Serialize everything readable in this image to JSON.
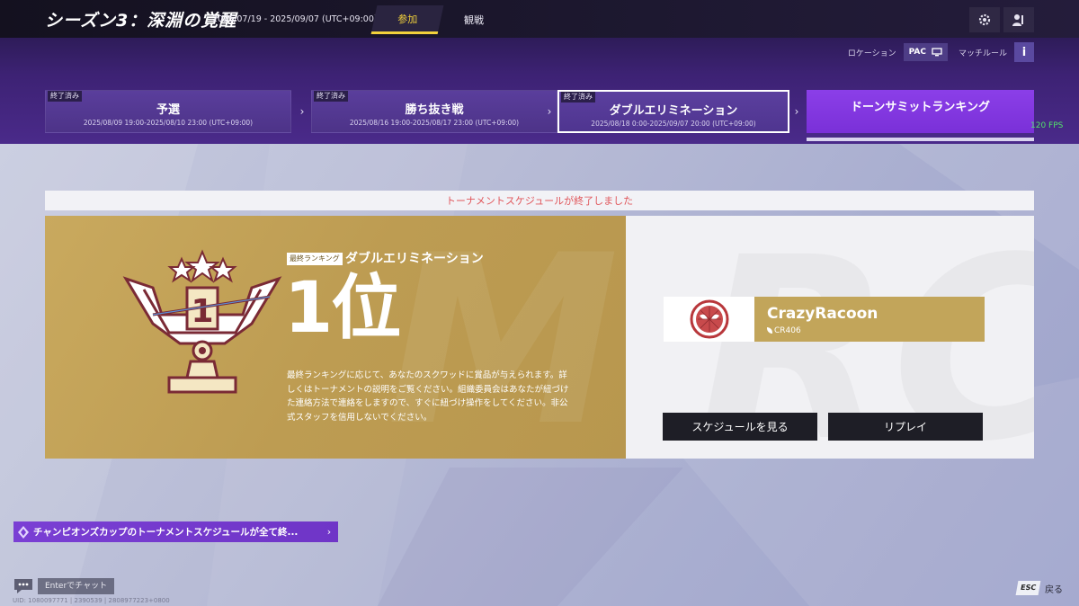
{
  "header": {
    "season_title": "シーズン3：深淵の覚醒",
    "season_dates": "2025/07/19 - 2025/09/07 (UTC+09:00)",
    "tabs": [
      {
        "label": "参加",
        "active": true
      },
      {
        "label": "観戦",
        "active": false
      }
    ],
    "icons": [
      "gear-icon",
      "friends-icon"
    ]
  },
  "location": {
    "label": "ロケーション",
    "region": "PAC",
    "match_rule_label": "マッチルール",
    "info_label": "i"
  },
  "stages": [
    {
      "tag": "終了済み",
      "name": "予選",
      "date": "2025/08/09 19:00-2025/08/10 23:00 (UTC+09:00)"
    },
    {
      "tag": "終了済み",
      "name": "勝ち抜き戦",
      "date": "2025/08/16 19:00-2025/08/17 23:00 (UTC+09:00)"
    },
    {
      "tag": "終了済み",
      "name": "ダブルエリミネーション",
      "date": "2025/08/18 0:00-2025/09/07 20:00 (UTC+09:00)"
    },
    {
      "tag": "",
      "name": "ドーンサミットランキング",
      "date": ""
    }
  ],
  "fps": "120 FPS",
  "notice": "トーナメントスケジュールが終了しました",
  "result": {
    "rank_tag": "最終ランキング",
    "stage_name": "ダブルエリミネーション",
    "rank": "1位",
    "description": "最終ランキングに応じて、あなたのスクワッドに賞品が与えられます。詳しくはトーナメントの説明をご覧ください。組織委員会はあなたが紐づけた連絡方法で連絡をしますので、すぐに紐づけ操作をしてください。非公式スタッフを信用しないでください。"
  },
  "team": {
    "name": "CrazyRacoon",
    "tag": "CR406",
    "logo_icon": "spider-emblem-icon"
  },
  "buttons": {
    "schedule": "スケジュールを見る",
    "replay": "リプレイ"
  },
  "champ_banner": "チャンピオンズカップのトーナメントスケジュールが全て終...",
  "chat": {
    "label": "Enterでチャット"
  },
  "uid_line": "UID: 1080097771 | 2390539 | 2808977223+0800",
  "esc": {
    "key": "ESC",
    "label": "戻る"
  },
  "colors": {
    "accent_yellow": "#f3d23b",
    "gold_panel": "#c9a95e",
    "stage_current": "#8b3fe8",
    "notice_text": "#e0565b",
    "fps_green": "#52e36b"
  }
}
